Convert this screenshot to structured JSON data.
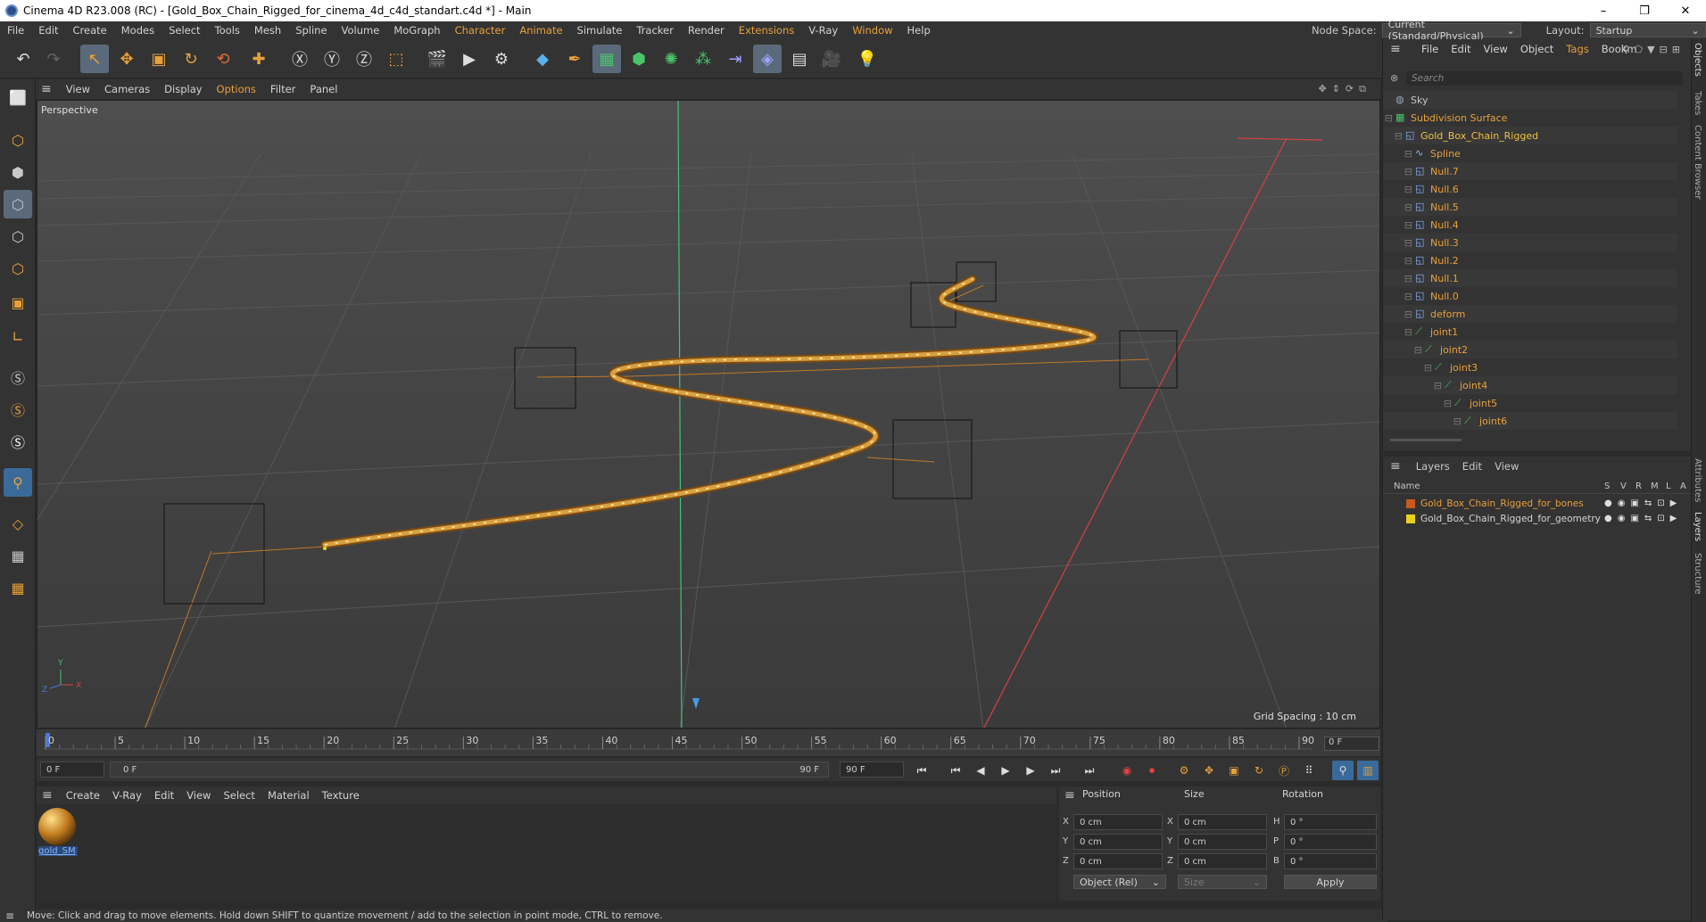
{
  "window": {
    "title": "Cinema 4D R23.008 (RC) - [Gold_Box_Chain_Rigged_for_cinema_4d_c4d_standart.c4d *] - Main",
    "controls": [
      "–",
      "❐",
      "✕"
    ]
  },
  "menubar": {
    "items": [
      "File",
      "Edit",
      "Create",
      "Modes",
      "Select",
      "Tools",
      "Mesh",
      "Spline",
      "Volume",
      "MoGraph",
      "Character",
      "Animate",
      "Simulate",
      "Tracker",
      "Render",
      "Extensions",
      "V-Ray",
      "Window",
      "Help"
    ],
    "node_space_label": "Node Space:",
    "node_space_value": "Current (Standard/Physical)",
    "layout_label": "Layout:",
    "layout_value": "Startup"
  },
  "viewport": {
    "menu": [
      "View",
      "Cameras",
      "Display",
      "Options",
      "Filter",
      "Panel"
    ],
    "label": "Perspective",
    "grid_spacing": "Grid Spacing : 10 cm",
    "axis": {
      "y": "Y",
      "z": "Z",
      "x": "X"
    }
  },
  "timeline": {
    "ticks": [
      "0",
      "5",
      "10",
      "15",
      "20",
      "25",
      "30",
      "35",
      "40",
      "45",
      "50",
      "55",
      "60",
      "65",
      "70",
      "75",
      "80",
      "85",
      "90"
    ],
    "current_frame": "0 F"
  },
  "controls": {
    "start_field": "0 F",
    "range_start": "0 F",
    "range_end": "90 F",
    "end_field": "90 F"
  },
  "material_manager": {
    "menu": [
      "Create",
      "V-Ray",
      "Edit",
      "View",
      "Select",
      "Material",
      "Texture"
    ],
    "material_name": "gold_SM"
  },
  "coordinates": {
    "headers": [
      "Position",
      "Size",
      "Rotation"
    ],
    "position": [
      {
        "axis": "X",
        "value": "0 cm"
      },
      {
        "axis": "Y",
        "value": "0 cm"
      },
      {
        "axis": "Z",
        "value": "0 cm"
      }
    ],
    "size": [
      {
        "axis": "X",
        "value": "0 cm"
      },
      {
        "axis": "Y",
        "value": "0 cm"
      },
      {
        "axis": "Z",
        "value": "0 cm"
      }
    ],
    "rotation": [
      {
        "axis": "H",
        "value": "0 °"
      },
      {
        "axis": "P",
        "value": "0 °"
      },
      {
        "axis": "B",
        "value": "0 °"
      }
    ],
    "mode": "Object (Rel)",
    "size_mode": "Size",
    "apply": "Apply"
  },
  "status": {
    "text": "Move: Click and drag to move elements. Hold down SHIFT to quantize movement / add to the selection in point mode, CTRL to remove."
  },
  "object_manager": {
    "menu": [
      "File",
      "Edit",
      "View",
      "Object",
      "Tags",
      "Bookm"
    ],
    "search_placeholder": "Search",
    "items": [
      {
        "name": "Sky",
        "depth": 0,
        "color": "#c8c8c8",
        "icon": "sky-icon"
      },
      {
        "name": "Subdivision Surface",
        "depth": 0,
        "color": "#e8a03a",
        "icon": "subdivision-icon"
      },
      {
        "name": "Gold_Box_Chain_Rigged",
        "depth": 1,
        "color": "#f0c040",
        "icon": "null-icon"
      },
      {
        "name": "Spline",
        "depth": 2,
        "color": "#e8a03a",
        "icon": "spline-icon"
      },
      {
        "name": "Null.7",
        "depth": 2,
        "color": "#e8a03a",
        "icon": "null-icon"
      },
      {
        "name": "Null.6",
        "depth": 2,
        "color": "#e8a03a",
        "icon": "null-icon"
      },
      {
        "name": "Null.5",
        "depth": 2,
        "color": "#e8a03a",
        "icon": "null-icon"
      },
      {
        "name": "Null.4",
        "depth": 2,
        "color": "#e8a03a",
        "icon": "null-icon"
      },
      {
        "name": "Null.3",
        "depth": 2,
        "color": "#e8a03a",
        "icon": "null-icon"
      },
      {
        "name": "Null.2",
        "depth": 2,
        "color": "#e8a03a",
        "icon": "null-icon"
      },
      {
        "name": "Null.1",
        "depth": 2,
        "color": "#e8a03a",
        "icon": "null-icon"
      },
      {
        "name": "Null.0",
        "depth": 2,
        "color": "#e8a03a",
        "icon": "null-icon"
      },
      {
        "name": "deform",
        "depth": 2,
        "color": "#e8a03a",
        "icon": "null-icon"
      },
      {
        "name": "joint1",
        "depth": 2,
        "color": "#e8a03a",
        "icon": "joint-icon"
      },
      {
        "name": "joint2",
        "depth": 3,
        "color": "#e8a03a",
        "icon": "joint-icon"
      },
      {
        "name": "joint3",
        "depth": 4,
        "color": "#e8a03a",
        "icon": "joint-icon"
      },
      {
        "name": "joint4",
        "depth": 5,
        "color": "#e8a03a",
        "icon": "joint-icon"
      },
      {
        "name": "joint5",
        "depth": 6,
        "color": "#e8a03a",
        "icon": "joint-icon"
      },
      {
        "name": "joint6",
        "depth": 7,
        "color": "#e8a03a",
        "icon": "joint-icon"
      }
    ]
  },
  "layer_manager": {
    "menu": [
      "Layers",
      "Edit",
      "View"
    ],
    "columns": [
      "Name",
      "S",
      "V",
      "R",
      "M",
      "L",
      "A"
    ],
    "layers": [
      {
        "name": "Gold_Box_Chain_Rigged_for_bones",
        "color": "#c85a1e",
        "text_color": "#e8a03a"
      },
      {
        "name": "Gold_Box_Chain_Rigged_for_geometry",
        "color": "#e8d21e",
        "text_color": "#d4d4d4"
      }
    ]
  },
  "right_tabs": [
    "Objects",
    "Takes",
    "Content Browser",
    "Attributes",
    "Layers",
    "Structure"
  ]
}
